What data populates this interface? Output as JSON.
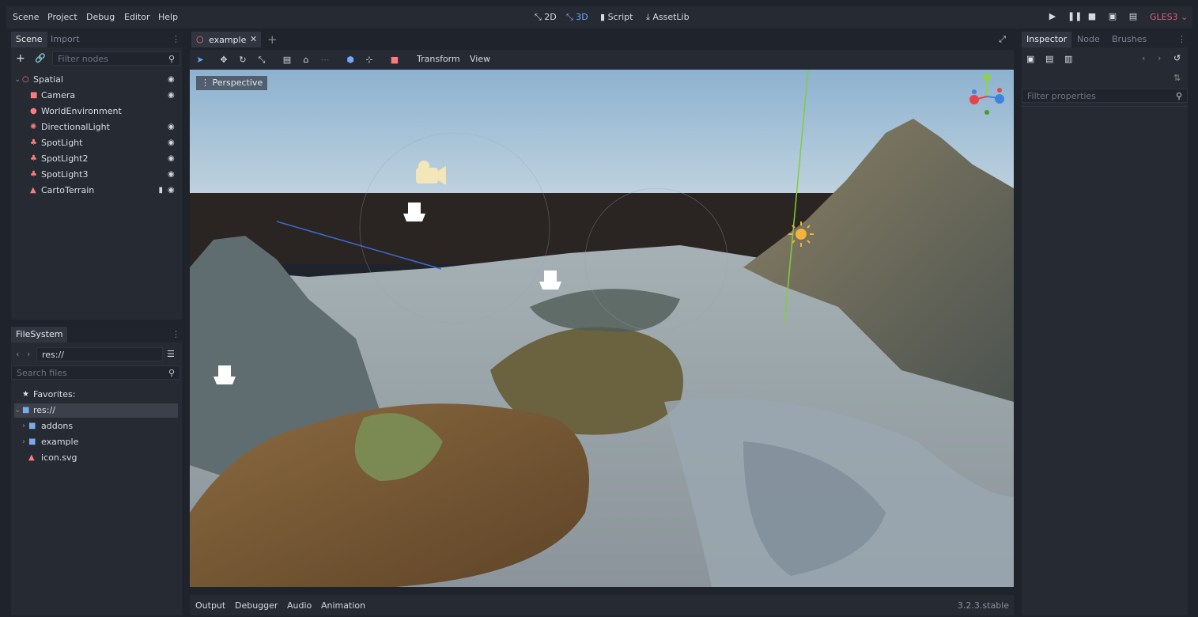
{
  "menu": {
    "items": [
      "Scene",
      "Project",
      "Debug",
      "Editor",
      "Help"
    ]
  },
  "modes": {
    "two_d": "2D",
    "three_d": "3D",
    "script": "Script",
    "assetlib": "AssetLib"
  },
  "renderer": "GLES3",
  "scene_panel": {
    "tabs": [
      "Scene",
      "Import"
    ],
    "filter_placeholder": "Filter nodes",
    "nodes": [
      {
        "label": "Spatial",
        "icon": "spatial-icon",
        "color": "#ff7b7b"
      },
      {
        "label": "Camera",
        "icon": "camera-icon",
        "color": "#ff7b7b"
      },
      {
        "label": "WorldEnvironment",
        "icon": "world-environment-icon",
        "color": "#ff7b7b"
      },
      {
        "label": "DirectionalLight",
        "icon": "directional-light-icon",
        "color": "#ff7b7b"
      },
      {
        "label": "SpotLight",
        "icon": "spotlight-icon",
        "color": "#ff7b7b"
      },
      {
        "label": "SpotLight2",
        "icon": "spotlight-icon",
        "color": "#ff7b7b"
      },
      {
        "label": "SpotLight3",
        "icon": "spotlight-icon",
        "color": "#ff7b7b"
      },
      {
        "label": "CartoTerrain",
        "icon": "terrain-icon",
        "color": "#ff7b7b"
      }
    ]
  },
  "filesystem": {
    "tab": "FileSystem",
    "path": "res://",
    "search_placeholder": "Search files",
    "favorites": "Favorites:",
    "items": [
      "res://",
      "addons",
      "example",
      "icon.svg"
    ]
  },
  "editor_tabs": {
    "scene_tab": "example"
  },
  "viewport_toolbar": {
    "transform": "Transform",
    "view": "View"
  },
  "viewport": {
    "perspective_label": "Perspective"
  },
  "bottom_panel": {
    "tabs": [
      "Output",
      "Debugger",
      "Audio",
      "Animation"
    ],
    "version": "3.2.3.stable"
  },
  "inspector": {
    "tabs": [
      "Inspector",
      "Node",
      "Brushes"
    ],
    "filter_placeholder": "Filter properties"
  },
  "colors": {
    "accent": "#6fa8ff",
    "renderer": "#e05d7a",
    "node_icon": "#ff7b7b",
    "folder": "#7fa8e8"
  }
}
